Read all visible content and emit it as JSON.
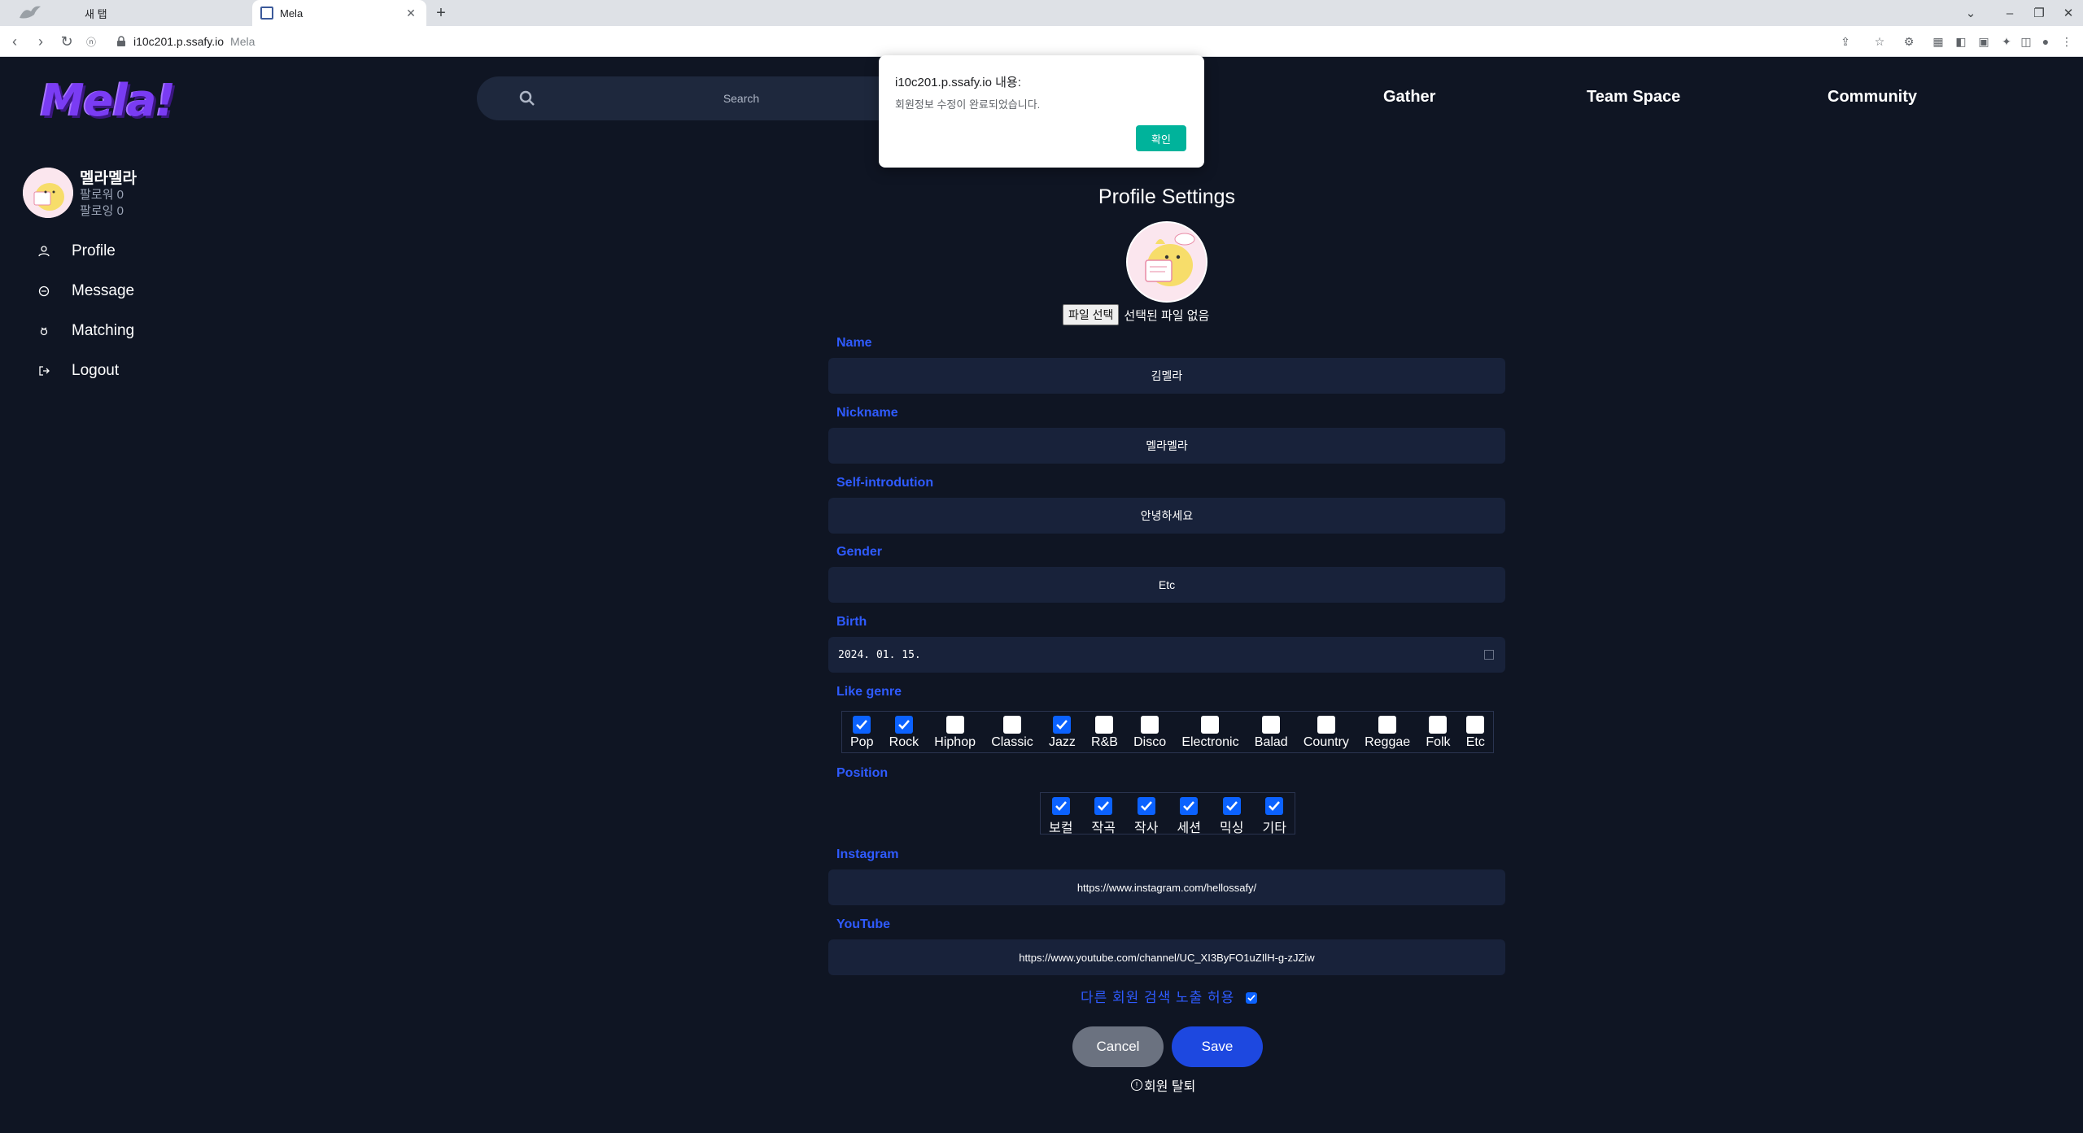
{
  "browser": {
    "tabs": [
      {
        "label": "새 탭",
        "active": false
      },
      {
        "label": "Mela",
        "active": true
      }
    ],
    "new_tab": "+",
    "address": {
      "host": "i10c201.p.ssafy.io",
      "page_title": "Mela"
    }
  },
  "site": {
    "logo": "Mela!",
    "search_placeholder": "Search",
    "nav": [
      "Gather",
      "Team Space",
      "Community"
    ]
  },
  "sidebar": {
    "username": "멜라멜라",
    "followers": "팔로워 0",
    "following": "팔로잉 0",
    "items": [
      {
        "label": "Profile",
        "icon": "user-icon"
      },
      {
        "label": "Message",
        "icon": "chat-icon"
      },
      {
        "label": "Matching",
        "icon": "matching-icon"
      },
      {
        "label": "Logout",
        "icon": "logout-icon"
      }
    ]
  },
  "form": {
    "title": "Profile Settings",
    "file_button": "파일 선택",
    "file_status": "선택된 파일 없음",
    "fields": {
      "name": {
        "label": "Name",
        "value": "김멜라"
      },
      "nickname": {
        "label": "Nickname",
        "value": "멜라멜라"
      },
      "intro": {
        "label": "Self-introdution",
        "value": "안녕하세요"
      },
      "gender": {
        "label": "Gender",
        "value": "Etc"
      },
      "birth": {
        "label": "Birth",
        "value": "2024. 01. 15."
      },
      "instagram": {
        "label": "Instagram",
        "value": "https://www.instagram.com/hellossafy/"
      },
      "youtube": {
        "label": "YouTube",
        "value": "https://www.youtube.com/channel/UC_XI3ByFO1uZIlH-g-zJZiw"
      }
    },
    "genre_label": "Like genre",
    "genres": [
      {
        "label": "Pop",
        "checked": true
      },
      {
        "label": "Rock",
        "checked": true
      },
      {
        "label": "Hiphop",
        "checked": false
      },
      {
        "label": "Classic",
        "checked": false
      },
      {
        "label": "Jazz",
        "checked": true
      },
      {
        "label": "R&B",
        "checked": false
      },
      {
        "label": "Disco",
        "checked": false
      },
      {
        "label": "Electronic",
        "checked": false
      },
      {
        "label": "Balad",
        "checked": false
      },
      {
        "label": "Country",
        "checked": false
      },
      {
        "label": "Reggae",
        "checked": false
      },
      {
        "label": "Folk",
        "checked": false
      },
      {
        "label": "Etc",
        "checked": false
      }
    ],
    "position_label": "Position",
    "positions": [
      {
        "label": "보컬",
        "checked": true
      },
      {
        "label": "작곡",
        "checked": true
      },
      {
        "label": "작사",
        "checked": true
      },
      {
        "label": "세션",
        "checked": true
      },
      {
        "label": "믹싱",
        "checked": true
      },
      {
        "label": "기타",
        "checked": true
      }
    ],
    "expose_label": "다른 회원 검색 노출 허용",
    "expose_checked": true,
    "cancel": "Cancel",
    "save": "Save",
    "withdraw": "회원 탈퇴",
    "withdraw_icon": "!"
  },
  "dialog": {
    "title": "i10c201.p.ssafy.io 내용:",
    "message": "회원정보 수정이 완료되었습니다.",
    "ok": "확인"
  },
  "colors": {
    "background": "#0f1523",
    "input_bg": "#18223a",
    "label_blue": "#2f5bff",
    "save_button": "#1d48e0",
    "cancel_button": "#6b7280",
    "dialog_ok": "#00b39b",
    "logo_purple": "#7a3cf3"
  }
}
